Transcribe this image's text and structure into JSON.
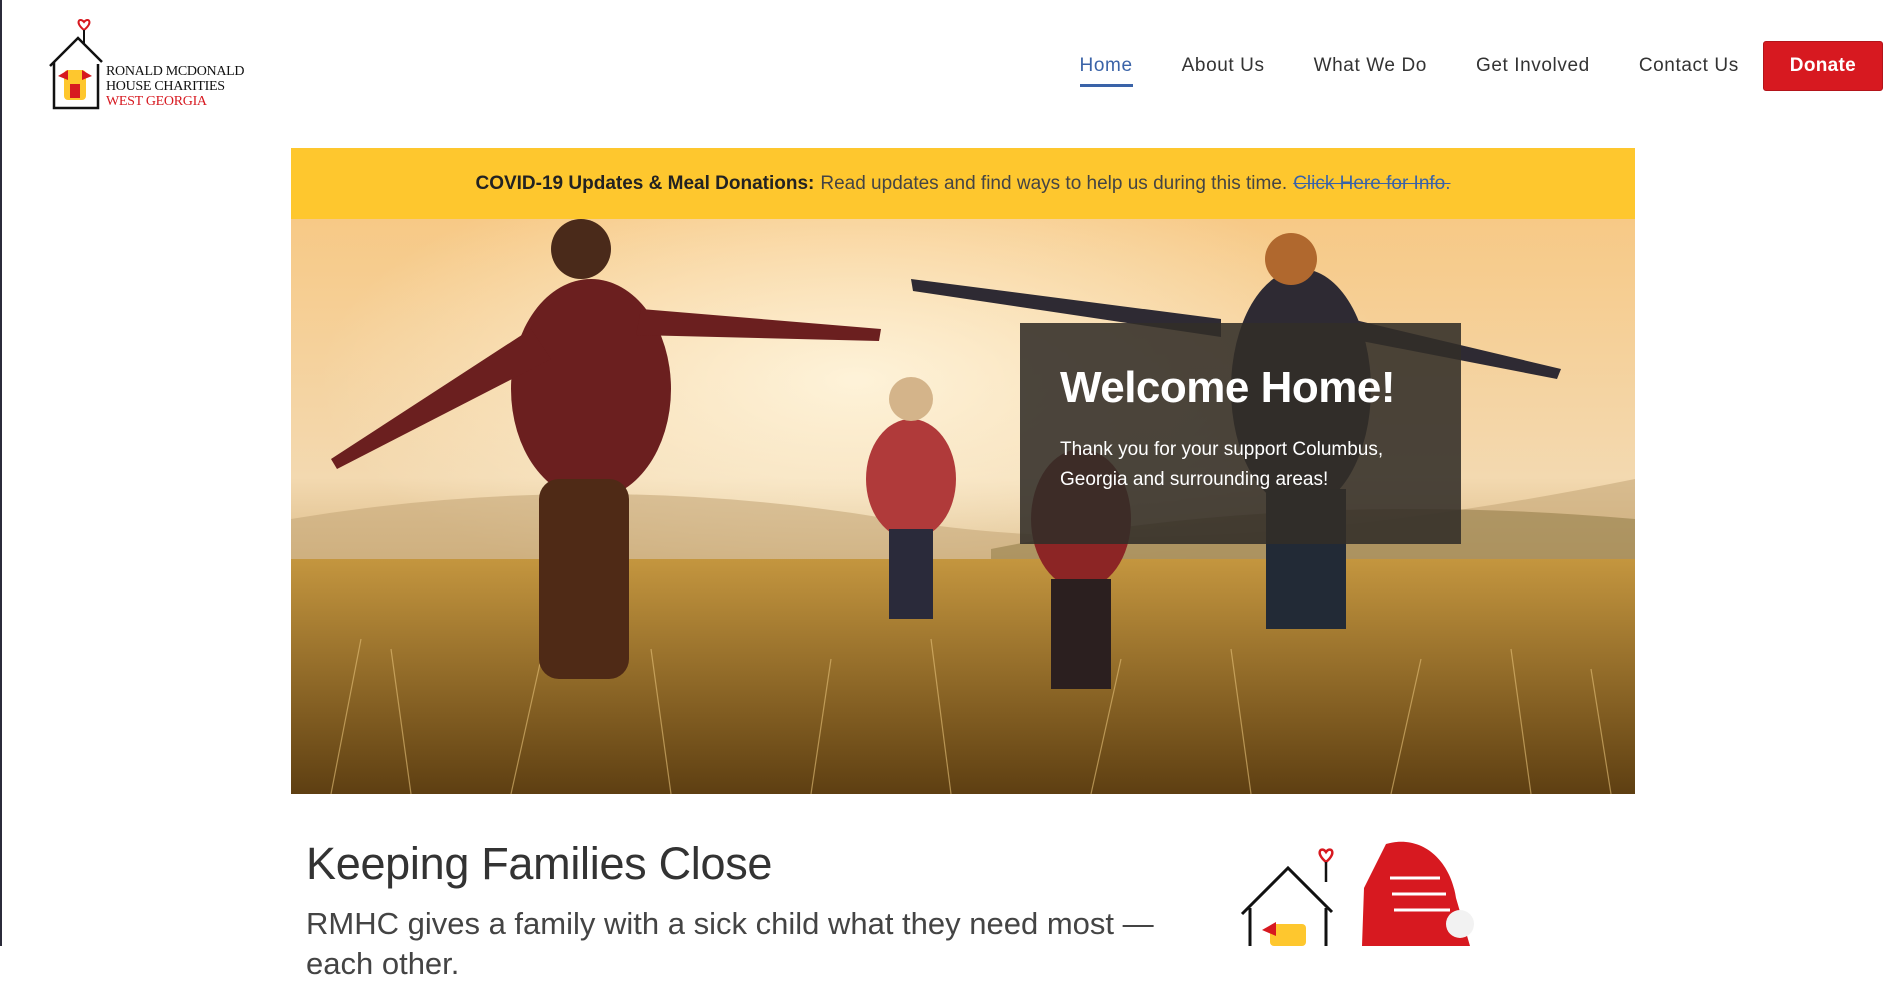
{
  "brand": {
    "line1": "RONALD MCDONALD",
    "line2": "HOUSE CHARITIES",
    "line3": "WEST GEORGIA"
  },
  "nav": {
    "items": [
      {
        "label": "Home"
      },
      {
        "label": "About Us"
      },
      {
        "label": "What We Do"
      },
      {
        "label": "Get Involved"
      },
      {
        "label": "Contact Us"
      }
    ],
    "donate_label": "Donate"
  },
  "banner": {
    "bold": "COVID-19 Updates & Meal Donations:",
    "text": "Read updates and find ways to help us during this time.",
    "link": "Click Here for Info."
  },
  "hero": {
    "title": "Welcome Home!",
    "text": "Thank you for your support Columbus, Georgia and surrounding areas!"
  },
  "section": {
    "title": "Keeping Families Close",
    "subtitle": "RMHC gives a family with a sick child what they need most — each other."
  },
  "colors": {
    "accent": "#3a63a8",
    "donate": "#d71920",
    "banner": "#fec72e"
  }
}
